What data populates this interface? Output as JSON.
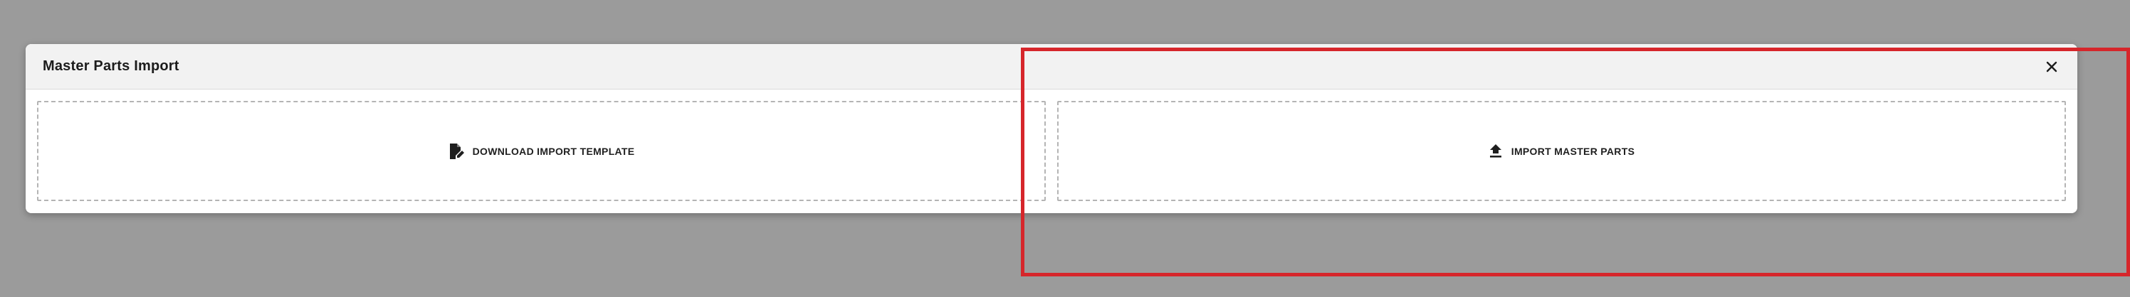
{
  "modal": {
    "title": "Master Parts Import",
    "close_icon": "close-icon"
  },
  "tiles": [
    {
      "label": "DOWNLOAD IMPORT TEMPLATE",
      "icon": "file-edit-icon"
    },
    {
      "label": "IMPORT MASTER PARTS",
      "icon": "upload-icon"
    }
  ],
  "colors": {
    "backdrop": "#9b9b9b",
    "header_bg": "#f2f2f2",
    "highlight": "#d6262b"
  }
}
